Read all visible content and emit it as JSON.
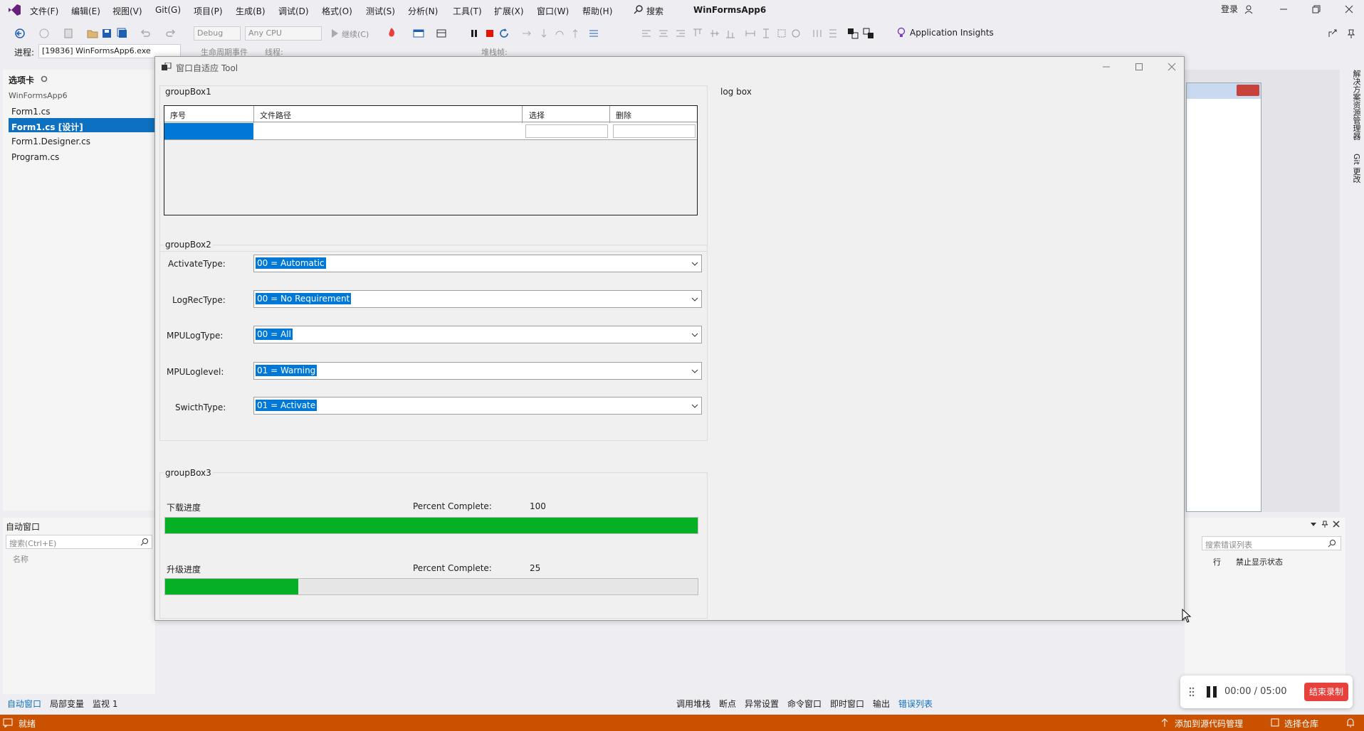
{
  "menu": {
    "items": [
      "文件(F)",
      "编辑(E)",
      "视图(V)",
      "Git(G)",
      "项目(P)",
      "生成(B)",
      "调试(D)",
      "格式(O)",
      "测试(S)",
      "分析(N)",
      "工具(T)",
      "扩展(X)",
      "窗口(W)",
      "帮助(H)"
    ],
    "search_label": "搜索",
    "solution_title": "WinFormsApp6",
    "login": "登录"
  },
  "toolbar": {
    "config": "Debug",
    "platform": "Any CPU",
    "continue_label": "继续(C)",
    "app_insights": "Application Insights",
    "process_label": "进程:",
    "process_value": "[19836] WinFormsApp6.exe",
    "lifecycle_label": "生命周期事件",
    "thread_label": "线程:",
    "stackframe_label": "堆栈帧:"
  },
  "left_panel": {
    "title": "选项卡",
    "project": "WinFormsApp6",
    "files": [
      "Form1.cs",
      "Form1.cs [设计]",
      "Form1.Designer.cs",
      "Program.cs"
    ],
    "selected_index": 1
  },
  "auto_panel": {
    "title": "自动窗口",
    "search_placeholder": "搜索(Ctrl+E)",
    "column_name": "名称"
  },
  "right_sidebar": {
    "tab1": "解决方案资源管理器",
    "tab2": "Git 更改"
  },
  "error_panel": {
    "search_placeholder": "搜索错误列表",
    "col_line": "行",
    "col_suppress": "禁止显示状态"
  },
  "tool_window": {
    "title": "窗口自适应 Tool",
    "groupbox1": {
      "title": "groupBox1",
      "columns": [
        "序号",
        "文件路径",
        "选择",
        "删除"
      ]
    },
    "groupbox2": {
      "title": "groupBox2",
      "fields": [
        {
          "label": "ActivateType:",
          "value": "00 = Automatic"
        },
        {
          "label": "LogRecType:",
          "value": "00 = No Requirement"
        },
        {
          "label": "MPULogType:",
          "value": "00 = All"
        },
        {
          "label": "MPULoglevel:",
          "value": "01 = Warning"
        },
        {
          "label": "SwicthType:",
          "value": "01 = Activate"
        }
      ]
    },
    "groupbox3": {
      "title": "groupBox3",
      "progress": [
        {
          "label": "下载进度",
          "caption": "Percent Complete:",
          "value": "100",
          "percent": 100
        },
        {
          "label": "升级进度",
          "caption": "Percent Complete:",
          "value": "25",
          "percent": 25
        }
      ]
    },
    "logbox_title": "log box"
  },
  "bottom_tabs": {
    "left": [
      "自动窗口",
      "局部变量",
      "监视 1"
    ],
    "right": [
      "调用堆栈",
      "断点",
      "异常设置",
      "命令窗口",
      "即时窗口",
      "输出",
      "错误列表"
    ]
  },
  "recorder": {
    "time": "00:00 / 05:00",
    "stop_label": "结束录制"
  },
  "status": {
    "ready": "就绪",
    "add_source": "添加到源代码管理",
    "select_repo": "选择仓库"
  },
  "colors": {
    "accent": "#0078d7",
    "status_bar": "#ca5100",
    "progress_green": "#06b025",
    "record_red": "#e8403a"
  }
}
